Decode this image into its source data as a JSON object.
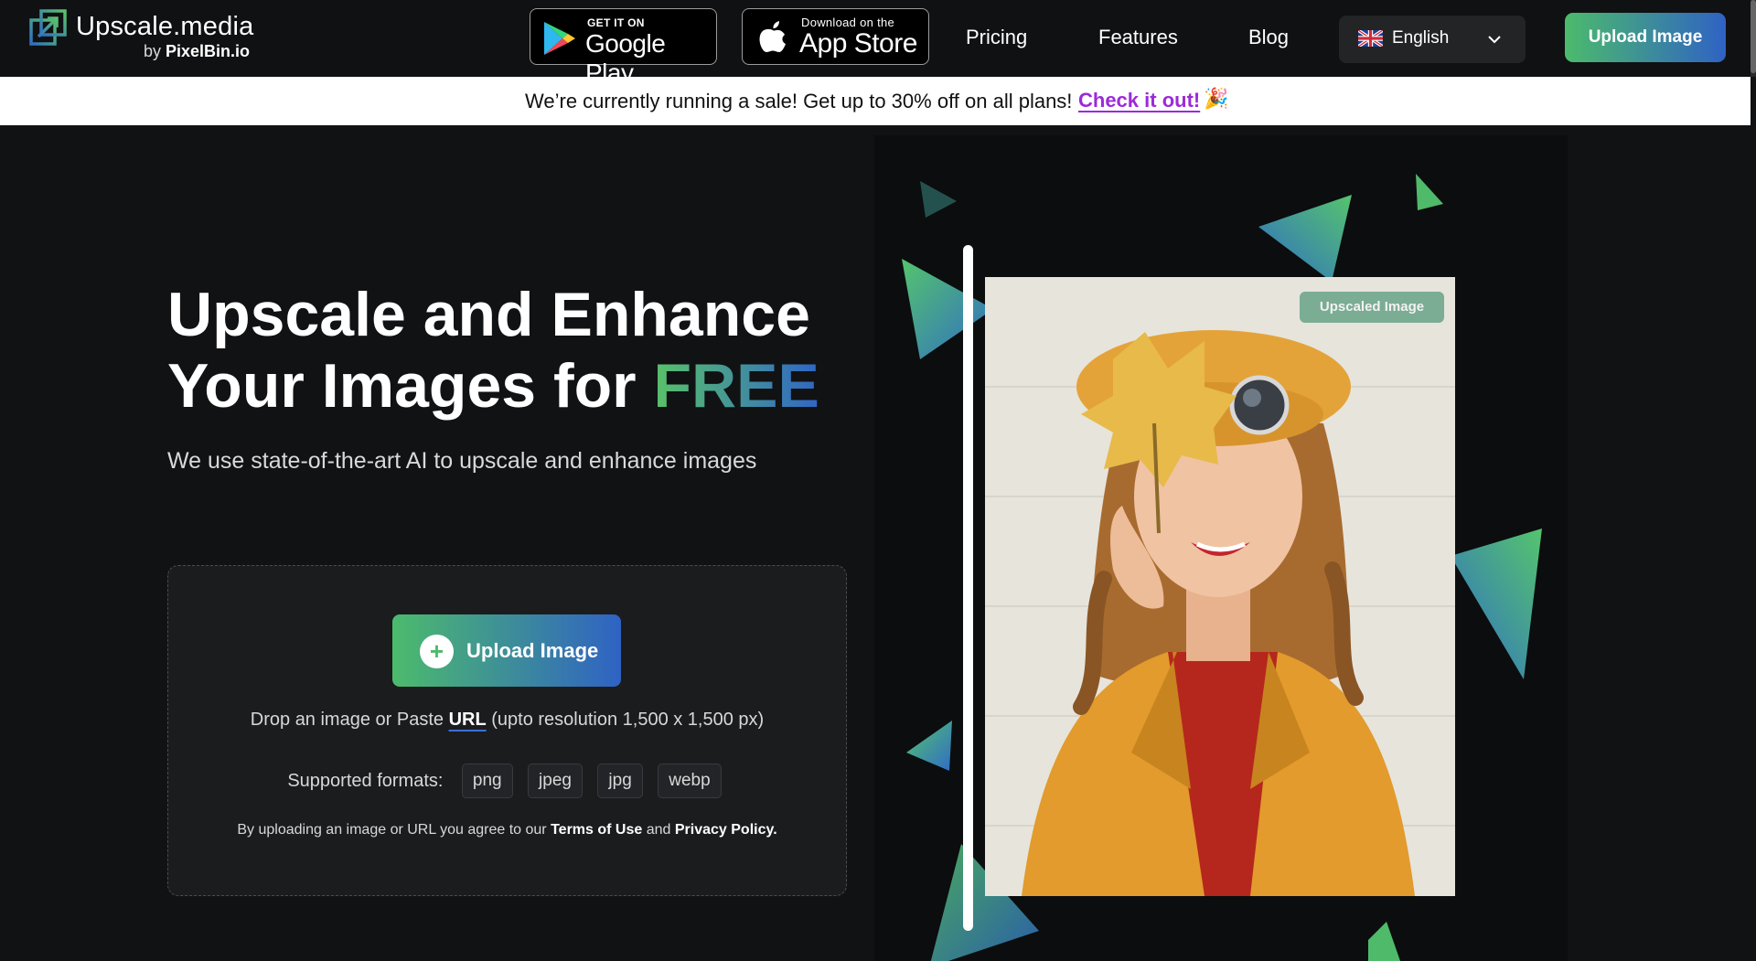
{
  "header": {
    "logo": {
      "name": "Upscale.media",
      "by": "by",
      "brand": "PixelBin.io"
    },
    "stores": {
      "google": {
        "small": "GET IT ON",
        "big": "Google Play"
      },
      "apple": {
        "small": "Download on the",
        "big": "App Store"
      }
    },
    "nav": {
      "pricing": "Pricing",
      "features": "Features",
      "blog": "Blog"
    },
    "language": {
      "selected": "English",
      "flag": "uk-flag-icon"
    },
    "upload_label": "Upload Image"
  },
  "banner": {
    "text": "We’re currently running a sale! Get up to 30% off on all plans!",
    "link": "Check it out!",
    "emoji": "🎉"
  },
  "hero": {
    "title_line1": "Upscale and Enhance",
    "title_line2_prefix": "Your Images for ",
    "title_highlight": "FREE",
    "subtitle": "We use state-of-the-art AI to upscale and enhance images"
  },
  "dropzone": {
    "upload_label": "Upload Image",
    "drop_prefix": "Drop an image or Paste ",
    "drop_url": "URL",
    "drop_suffix": " (upto resolution 1,500 x 1,500 px)",
    "formats_label": "Supported formats:",
    "formats": [
      "png",
      "jpeg",
      "jpg",
      "webp"
    ],
    "terms_prefix": "By uploading an image or URL you agree to our ",
    "terms_link": "Terms of Use",
    "terms_and": " and ",
    "privacy_link": "Privacy Policy."
  },
  "preview": {
    "badge": "Upscaled Image"
  },
  "colors": {
    "background": "#111214",
    "gradient_start": "#4cbb6c",
    "gradient_end": "#2f62c4",
    "banner_link": "#9b2bd8"
  }
}
